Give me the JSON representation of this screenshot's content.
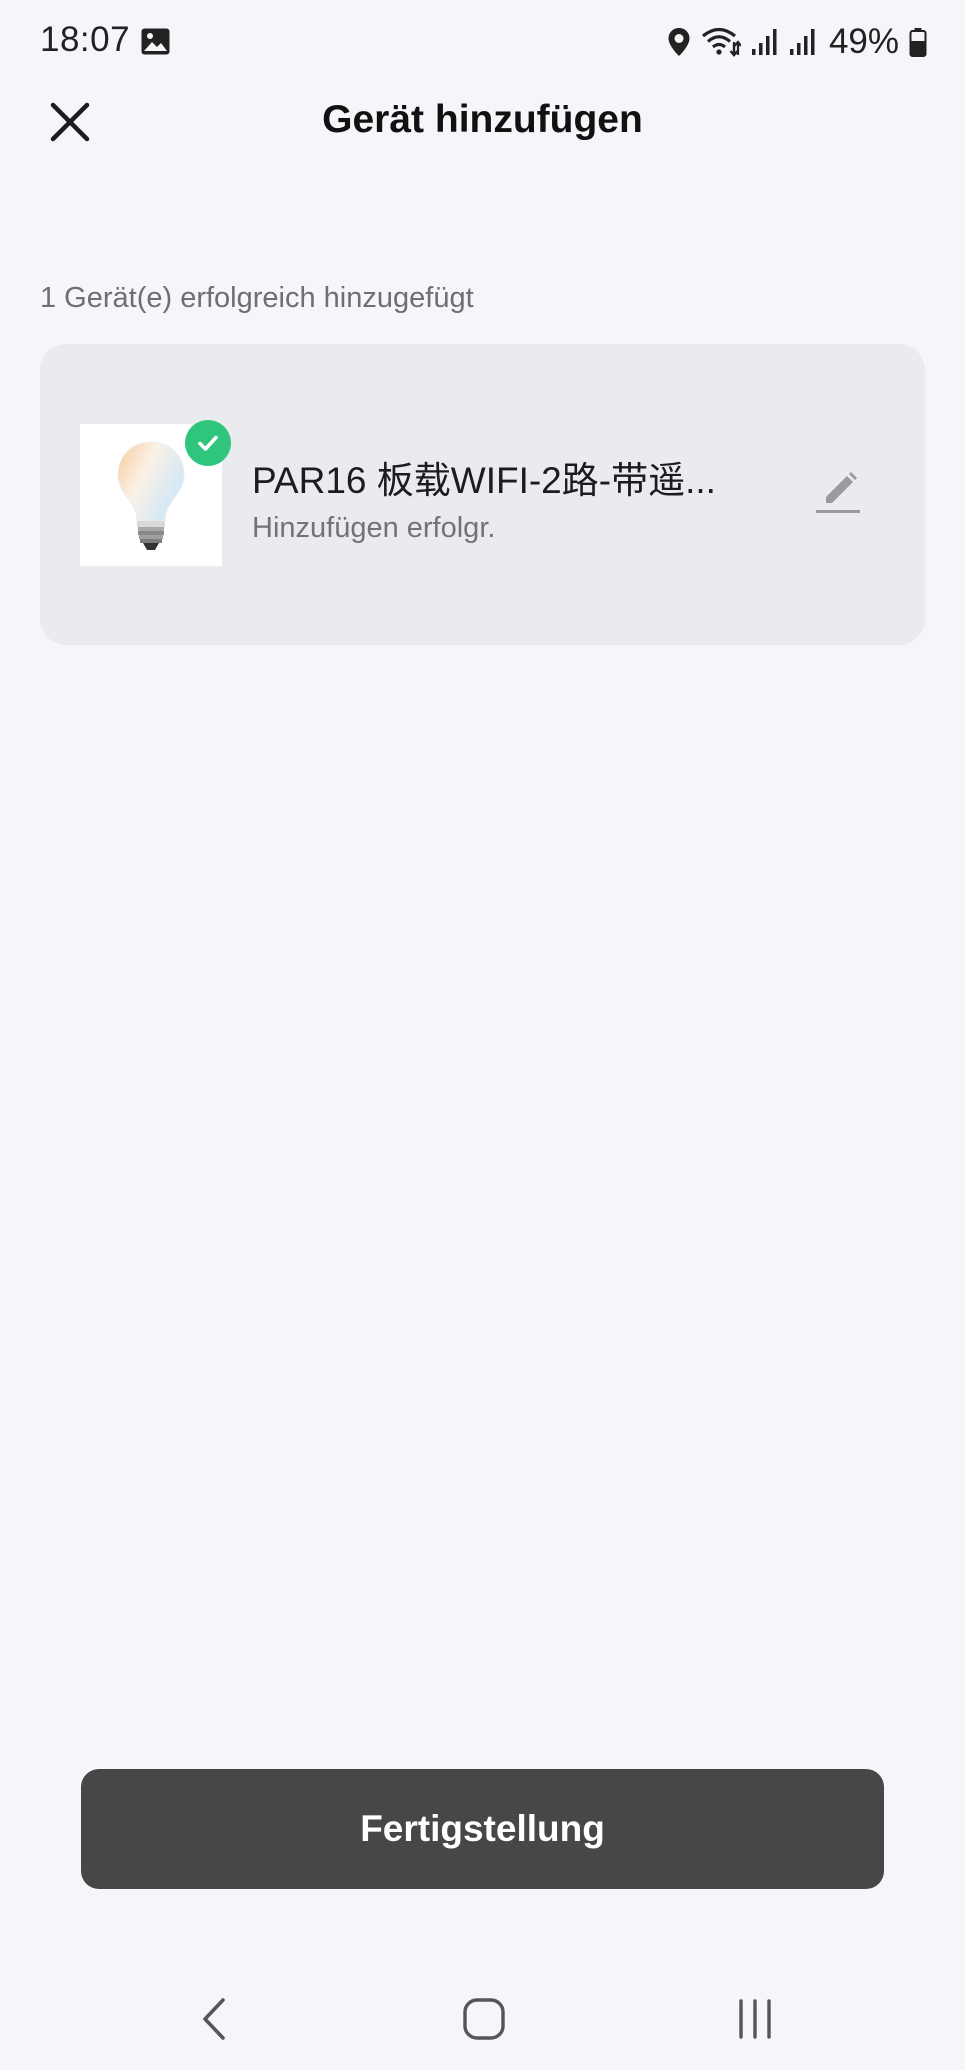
{
  "status_bar": {
    "time": "18:07",
    "battery_percent": "49%",
    "icons": [
      "gallery-icon",
      "location-icon",
      "wifi-icon",
      "signal-icon",
      "signal-icon",
      "battery-icon"
    ]
  },
  "header": {
    "title": "Gerät hinzufügen",
    "close_icon": "close-icon"
  },
  "section": {
    "label": "1 Gerät(e) erfolgreich hinzugefügt"
  },
  "device": {
    "name": "PAR16 板载WIFI-2路-带遥...",
    "status": "Hinzufügen erfolgr.",
    "image_icon": "light-bulb-icon",
    "badge_icon": "check-icon",
    "edit_icon": "edit-pencil-icon",
    "badge_color": "#2fc57d"
  },
  "footer": {
    "finish_label": "Fertigstellung",
    "button_color": "#474747"
  },
  "nav": {
    "icons": [
      "back-icon",
      "home-icon",
      "recent-apps-icon"
    ]
  }
}
